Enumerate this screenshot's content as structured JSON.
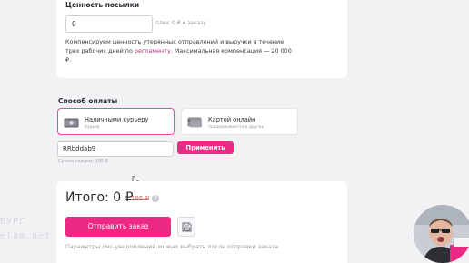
{
  "parcel_value": {
    "title": "Ценность посылки",
    "input_value": "0",
    "hint": "плюс 0 ₽ к заказу",
    "description_start": "Компенсируем ценность утерянных отправлений и выручки в течение трех рабочих дней по ",
    "description_link": "регламенту",
    "description_end": ". Максимальная компенсация — 20 000 ₽."
  },
  "payment": {
    "title": "Способ оплаты",
    "options": [
      {
        "name": "Наличными курьеру",
        "subtitle": "Курьер",
        "icon": "cash-icon",
        "selected": true
      },
      {
        "name": "Картой онлайн",
        "subtitle": "поддерживается в других",
        "icon": "card-icon",
        "selected": false
      }
    ],
    "promo_value": "RRbddab9",
    "apply_label": "Применить",
    "discount_text": "Сумма скидки: 195 ₽"
  },
  "total": {
    "label": "Итого: 0 ₽",
    "old_price": "195 ₽",
    "info_icon": "?",
    "submit_label": "Отправить заказ",
    "sms_note": "Параметры смс-уведомлений можно выбрать после отправки заказа"
  },
  "watermark": {
    "line1": "БУРГ",
    "line2": "elam.net"
  },
  "colors": {
    "accent": "#ec2a84",
    "accent_border": "#ec4e96",
    "link": "#a8387e"
  }
}
